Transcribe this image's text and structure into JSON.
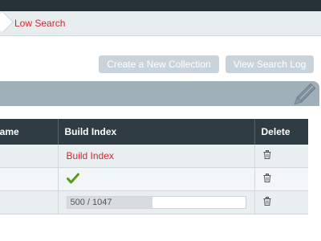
{
  "breadcrumb": {
    "current": "Low Search"
  },
  "toolbar": {
    "create_label": "Create a New Collection",
    "log_label": "View Search Log"
  },
  "table": {
    "headers": {
      "name": "Name",
      "build_index": "Build Index",
      "delete": "Delete"
    },
    "rows": [
      {
        "build_index_link": "Build Index"
      },
      {
        "build_status": "complete"
      },
      {
        "progress_text": "500 / 1047",
        "progress_fraction": 0.478
      }
    ]
  },
  "colors": {
    "accent": "#d7262e",
    "header_dark": "#2f3c43",
    "topbar": "#273238",
    "check_green": "#5a9a1c"
  },
  "icons": {
    "delete": "trash-icon",
    "complete": "checkmark-icon",
    "panel": "pencil-icon"
  }
}
